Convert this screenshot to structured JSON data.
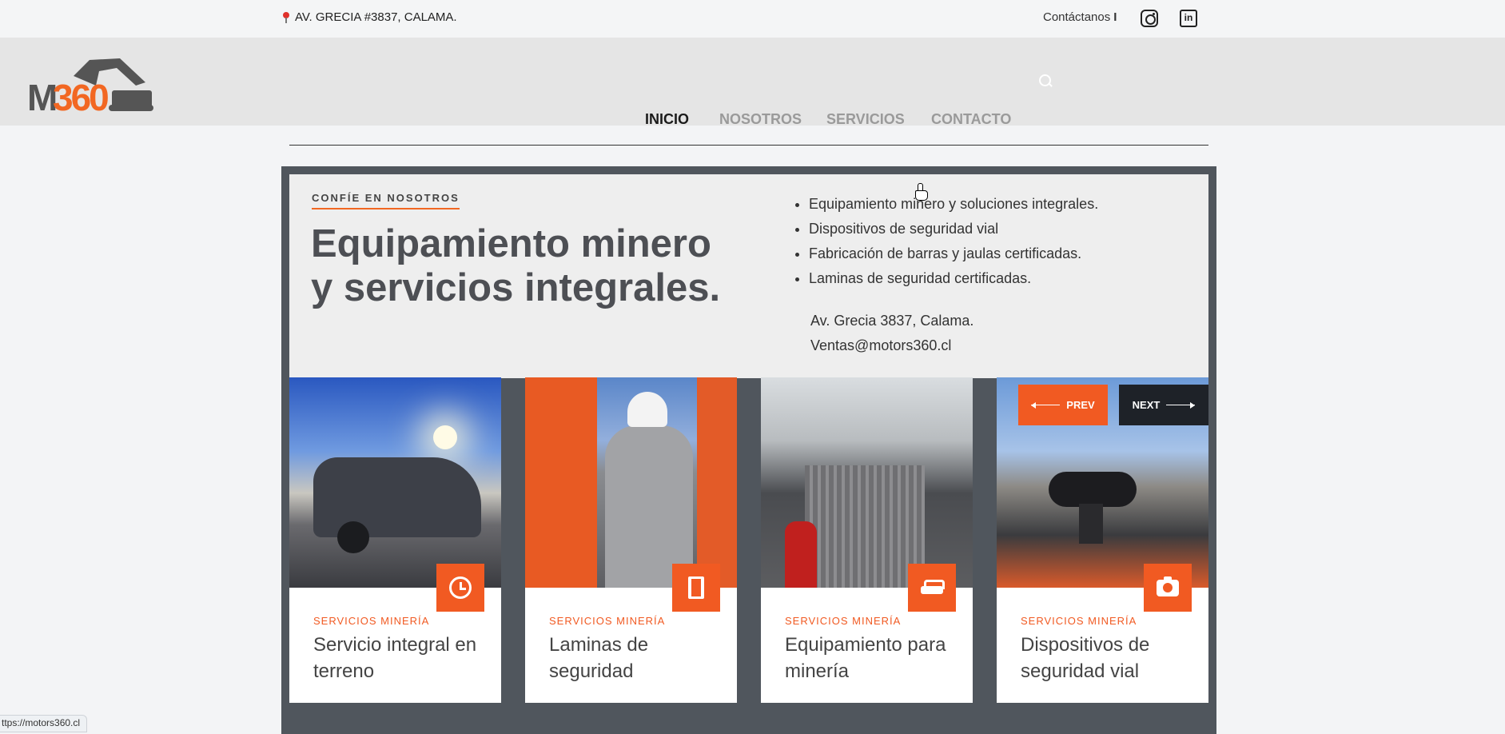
{
  "topbar": {
    "address": "AV. GRECIA #3837, CALAMA.",
    "contact_label": "Contáctanos",
    "contact_sep": "I"
  },
  "header": {
    "logo_m": "M",
    "logo_n": "360",
    "nav": [
      {
        "label": "INICIO",
        "active": true
      },
      {
        "label": "NOSOTROS"
      },
      {
        "label": "SERVICIOS"
      },
      {
        "label": "CONTACTO"
      }
    ]
  },
  "hero": {
    "eyebrow": "CONFÍE EN NOSOTROS",
    "headline_line1": "Equipamiento minero",
    "headline_line2": "y servicios integrales.",
    "bullets": [
      "Equipamiento minero y soluciones integrales.",
      "Dispositivos de seguridad vial",
      "Fabricación de barras y jaulas certificadas.",
      "Laminas de seguridad certificadas."
    ],
    "address": "Av. Grecia 3837, Calama.",
    "email": "Ventas@motors360.cl"
  },
  "carousel": {
    "prev_label": "PREV",
    "next_label": "NEXT"
  },
  "cards": [
    {
      "category": "SERVICIOS MINERÍA",
      "title": "Servicio integral en terreno",
      "icon": "clock-icon"
    },
    {
      "category": "SERVICIOS MINERÍA",
      "title": "Laminas de seguridad",
      "icon": "sheet-icon"
    },
    {
      "category": "SERVICIOS MINERÍA",
      "title": "Equipamiento para minería",
      "icon": "car-icon"
    },
    {
      "category": "SERVICIOS MINERÍA",
      "title": "Dispositivos de seguridad vial",
      "icon": "camera-icon"
    }
  ],
  "status_url": "ttps://motors360.cl",
  "colors": {
    "accent": "#f15a22",
    "panel": "#50565d",
    "dark_button": "#1e2228"
  }
}
